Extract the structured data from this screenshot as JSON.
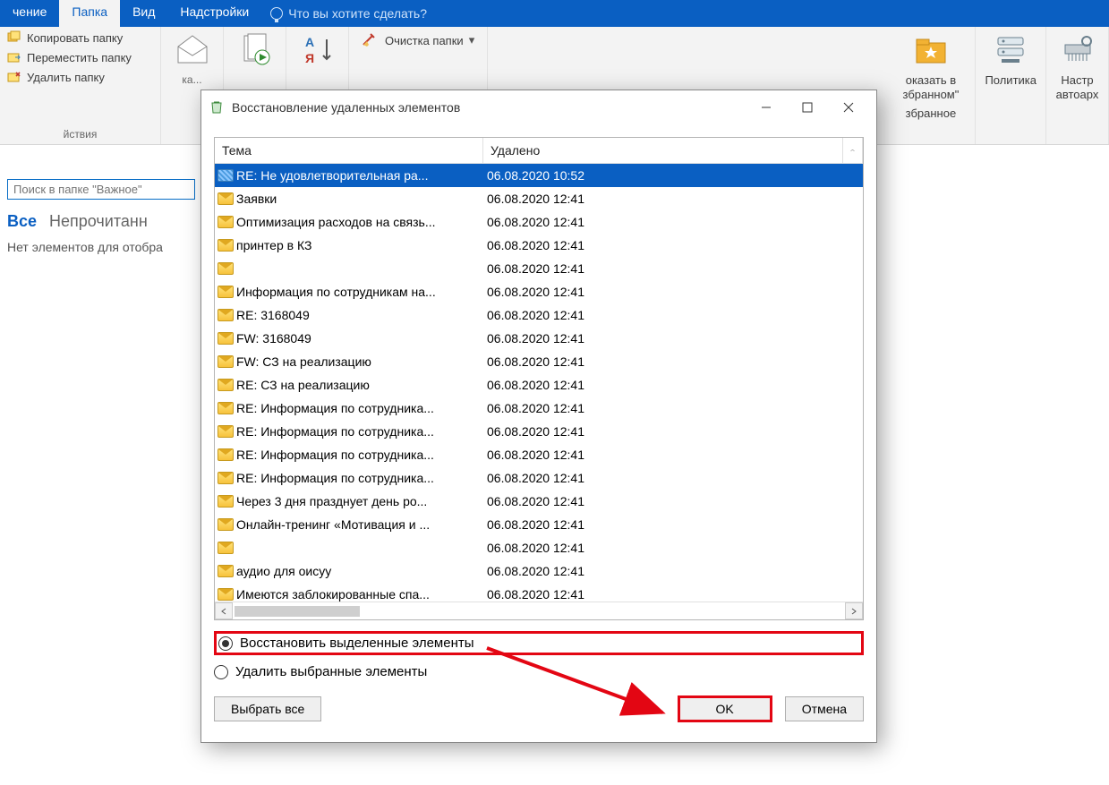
{
  "ribbon": {
    "tabs": [
      "чение",
      "Папка",
      "Вид",
      "Надстройки"
    ],
    "active_tab": 1,
    "tellme_placeholder": "Что вы хотите сделать?",
    "group1": {
      "copy": "Копировать папку",
      "move": "Переместить папку",
      "delete": "Удалить папку",
      "label": "йствия"
    },
    "cleanup_label": "Очистка папки",
    "show_fav": {
      "line1": "оказать в",
      "line2": "збранном\"",
      "line3": "збранное"
    },
    "policy": "Политика",
    "autoarchive": {
      "line1": "Настр",
      "line2": "автоарх"
    }
  },
  "left": {
    "search_placeholder": "Поиск в папке \"Важное\"",
    "all": "Все",
    "unread": "Непрочитанн",
    "empty": "Нет элементов для отобра"
  },
  "modal": {
    "title": "Восстановление удаленных элементов",
    "col_subject": "Тема",
    "col_deleted": "Удалено",
    "restore_label": "Восстановить выделенные элементы",
    "delete_label": "Удалить выбранные элементы",
    "select_all": "Выбрать все",
    "ok": "OK",
    "cancel": "Отмена",
    "rows": [
      {
        "subject": "RE: Не удовлетворительная ра...",
        "deleted": "06.08.2020 10:52",
        "selected": true
      },
      {
        "subject": "Заявки",
        "deleted": "06.08.2020 12:41"
      },
      {
        "subject": "Оптимизация расходов на связь...",
        "deleted": "06.08.2020 12:41"
      },
      {
        "subject": "принтер в КЗ",
        "deleted": "06.08.2020 12:41"
      },
      {
        "subject": "",
        "deleted": "06.08.2020 12:41"
      },
      {
        "subject": "Информация по сотрудникам на...",
        "deleted": "06.08.2020 12:41"
      },
      {
        "subject": "RE: 3168049",
        "deleted": "06.08.2020 12:41"
      },
      {
        "subject": "FW: 3168049",
        "deleted": "06.08.2020 12:41"
      },
      {
        "subject": "FW: СЗ на реализацию",
        "deleted": "06.08.2020 12:41"
      },
      {
        "subject": "RE: СЗ на реализацию",
        "deleted": "06.08.2020 12:41"
      },
      {
        "subject": "RE: Информация по сотрудника...",
        "deleted": "06.08.2020 12:41"
      },
      {
        "subject": "RE: Информация по сотрудника...",
        "deleted": "06.08.2020 12:41"
      },
      {
        "subject": "RE: Информация по сотрудника...",
        "deleted": "06.08.2020 12:41"
      },
      {
        "subject": "RE: Информация по сотрудника...",
        "deleted": "06.08.2020 12:41"
      },
      {
        "subject": "Через 3 дня празднует день ро...",
        "deleted": "06.08.2020 12:41"
      },
      {
        "subject": "Онлайн-тренинг «Мотивация и ...",
        "deleted": "06.08.2020 12:41"
      },
      {
        "subject": "",
        "deleted": "06.08.2020 12:41"
      },
      {
        "subject": "аудио для оисуу",
        "deleted": "06.08.2020 12:41"
      },
      {
        "subject": "Имеются заблокированные спа...",
        "deleted": "06.08.2020 12:41"
      }
    ]
  }
}
